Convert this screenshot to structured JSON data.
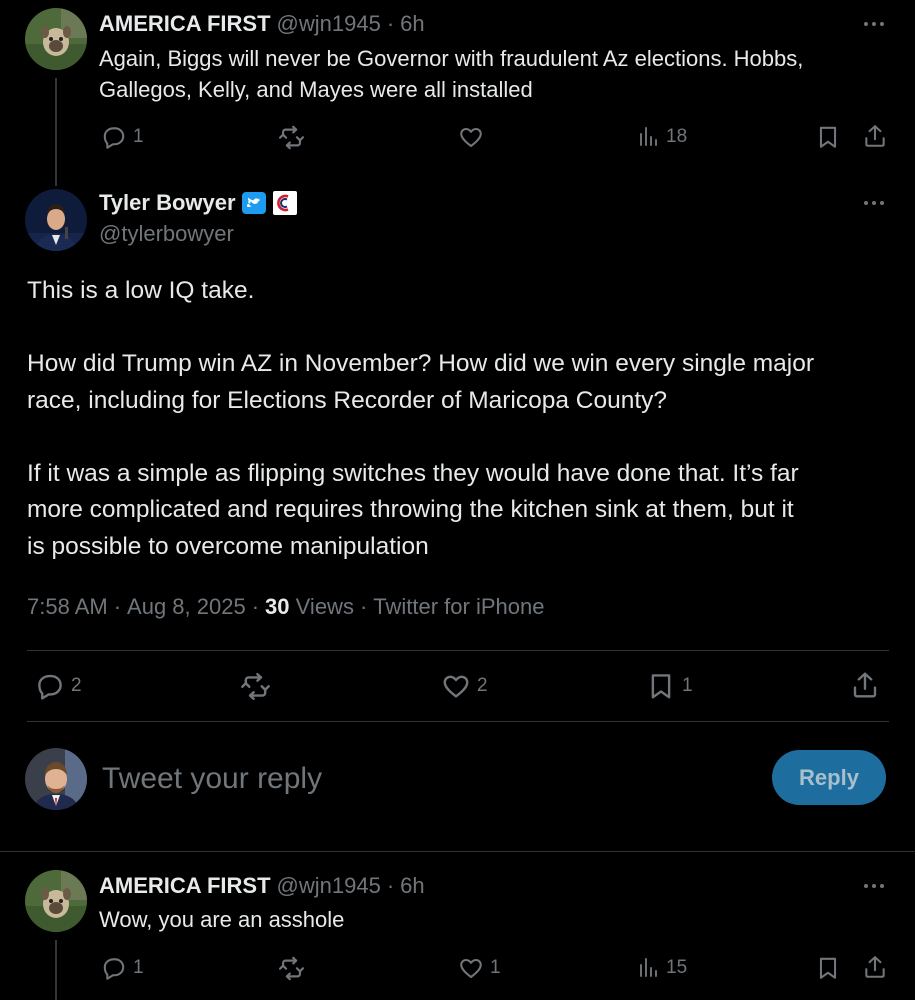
{
  "reply1": {
    "author": "AMERICA FIRST",
    "handle": "@wjn1945",
    "time": "6h",
    "text_line1": "Again, Biggs will never be Governor with fraudulent Az elections. Hobbs,",
    "text_line2": "Gallegos, Kelly, and Mayes were all installed",
    "replies": "1",
    "retweets": "",
    "likes": "",
    "views": "18"
  },
  "main_tweet": {
    "author": "Tyler Bowyer",
    "handle": "@tylerbowyer",
    "verified_icon": "twitter-verified-icon",
    "affiliate_icon": "affiliate-badge-icon",
    "para1": "This is a low IQ take.",
    "para2_line1": "How did Trump win AZ in November? How did we win every single major",
    "para2_line2": "race, including for Elections Recorder of Maricopa County?",
    "para3_line1": "If it was a simple as flipping switches they would have done that. It’s far",
    "para3_line2": "more complicated and requires throwing the kitchen sink at them, but it",
    "para3_line3": "is possible to overcome manipulation",
    "time": "7:58 AM",
    "date": "Aug 8, 2025",
    "views_count": "30",
    "views_label": "Views",
    "source": "Twitter for iPhone",
    "replies": "2",
    "retweets": "",
    "likes": "2",
    "bookmarks": "1"
  },
  "compose": {
    "placeholder": "Tweet your reply",
    "button": "Reply"
  },
  "reply2": {
    "author": "AMERICA FIRST",
    "handle": "@wjn1945",
    "time": "6h",
    "text": "Wow, you are an asshole",
    "replies": "1",
    "retweets": "",
    "likes": "1",
    "views": "15"
  },
  "separator": "·",
  "colors": {
    "background": "#000000",
    "text": "#e7e9ea",
    "muted": "#71767b",
    "divider": "#2f3336",
    "verified": "#1d9bf0",
    "reply_button": "#1d6e9e"
  }
}
